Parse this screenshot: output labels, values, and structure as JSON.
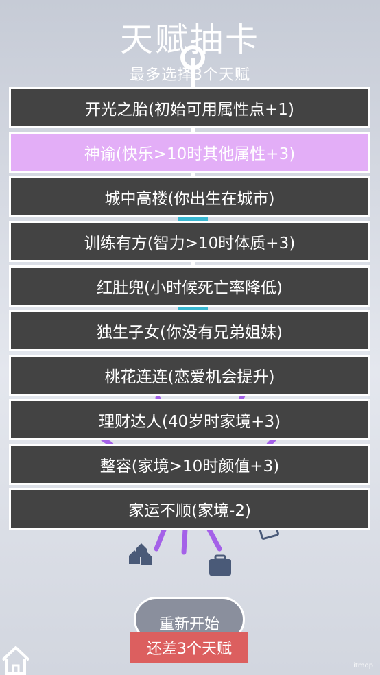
{
  "header": {
    "title": "天赋抽卡",
    "subtitle": "最多选择3个天赋"
  },
  "talents": [
    {
      "label": "开光之胎(初始可用属性点+1)",
      "selected": false
    },
    {
      "label": "神谕(快乐>10时其他属性+3)",
      "selected": true
    },
    {
      "label": "城中高楼(你出生在城市)",
      "selected": false
    },
    {
      "label": "训练有方(智力>10时体质+3)",
      "selected": false
    },
    {
      "label": "红肚兜(小时候死亡率降低)",
      "selected": false
    },
    {
      "label": "独生子女(你没有兄弟姐妹)",
      "selected": false
    },
    {
      "label": "桃花连连(恋爱机会提升)",
      "selected": false
    },
    {
      "label": "理财达人(40岁时家境+3)",
      "selected": false
    },
    {
      "label": "整容(家境>10时颜值+3)",
      "selected": false
    },
    {
      "label": "家运不顺(家境-2)",
      "selected": false
    }
  ],
  "footer": {
    "restart_label": "重新开始",
    "remaining_label": "还差3个天赋"
  },
  "watermark": "itmop",
  "colors": {
    "card_bg": "#434343",
    "card_selected": "#e3aef7",
    "card_border": "#ffffff",
    "restart_bg": "#8a8f9d",
    "remaining_bg": "#dc5f5f",
    "background": "#d8dce4"
  },
  "icons": [
    "home-icon",
    "suitcase-icon",
    "houses-icon",
    "lollipop-icon"
  ]
}
